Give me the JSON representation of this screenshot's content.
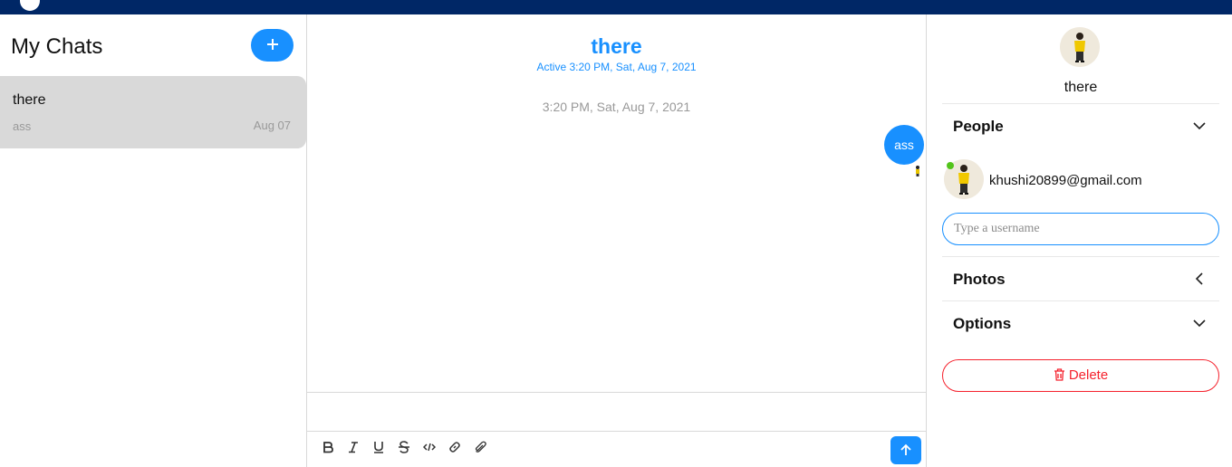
{
  "sidebar": {
    "title": "My Chats",
    "new_chat_icon": "plus-icon",
    "chats": [
      {
        "name": "there",
        "last_message": "ass",
        "date": "Aug 07"
      }
    ]
  },
  "chat": {
    "title": "there",
    "active": "Active 3:20 PM, Sat, Aug 7, 2021",
    "timestamp": "3:20 PM, Sat, Aug 7, 2021",
    "messages": [
      {
        "text": "ass",
        "sender": "self"
      }
    ],
    "toolbar": {
      "icons": [
        "bold-icon",
        "italic-icon",
        "underline-icon",
        "strikethrough-icon",
        "code-icon",
        "link-icon",
        "attachment-icon"
      ],
      "send_icon": "arrow-up-icon"
    }
  },
  "settings": {
    "chat_name": "there",
    "people_label": "People",
    "person_email": "khushi20899@gmail.com",
    "username_placeholder": "Type a username",
    "photos_label": "Photos",
    "options_label": "Options",
    "delete_label": "Delete"
  },
  "colors": {
    "accent": "#1890ff",
    "topbar": "#002766",
    "danger": "#f5222d",
    "selected_chat": "#d9d9d9",
    "online": "#52c41a"
  }
}
